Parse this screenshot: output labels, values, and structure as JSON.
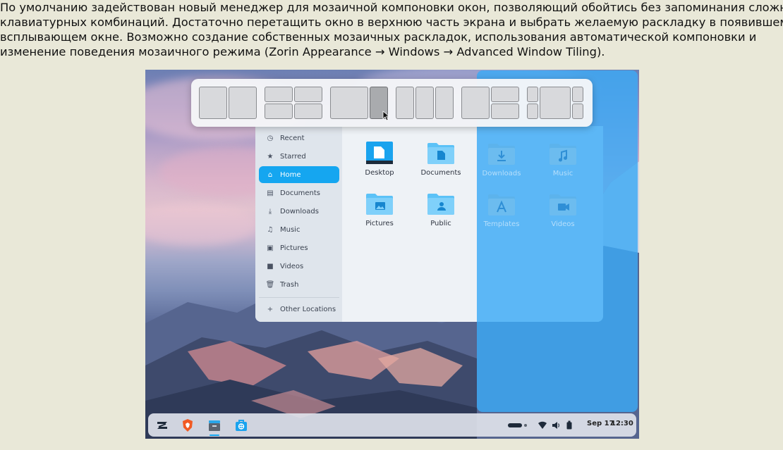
{
  "article": {
    "line1": "По умолчанию задействован новый менеджер для мозаичной компоновки окон, позволяющий обойтись без запоминания сложных",
    "line2": "клавиатурных комбинаций. Достаточно перетащить окно в верхнюю часть экрана и выбрать желаемую раскладку в появившемся",
    "line3": "всплывающем окне. Возможно создание собственных мозаичных раскладок, использования автоматической компоновки и",
    "line4": "изменение поведения мозаичного режима (Zorin Appearance → Windows → Advanced Window Tiling)."
  },
  "tiling_popup": {
    "layouts": [
      "two-columns",
      "four-grid",
      "wide-left-narrow-right",
      "three-columns",
      "left-plus-two-right",
      "center-focus"
    ],
    "highlighted_tile": "narrow-right-of-layout-3"
  },
  "files_window": {
    "sidebar": [
      {
        "label": "Recent",
        "icon": "clock-icon"
      },
      {
        "label": "Starred",
        "icon": "star-icon"
      },
      {
        "label": "Home",
        "icon": "home-icon",
        "active": true
      },
      {
        "label": "Documents",
        "icon": "document-icon"
      },
      {
        "label": "Downloads",
        "icon": "download-icon"
      },
      {
        "label": "Music",
        "icon": "music-icon"
      },
      {
        "label": "Pictures",
        "icon": "picture-icon"
      },
      {
        "label": "Videos",
        "icon": "video-icon"
      },
      {
        "label": "Trash",
        "icon": "trash-icon"
      },
      {
        "label": "Other Locations",
        "icon": "plus-icon"
      }
    ],
    "folders": [
      {
        "label": "Desktop"
      },
      {
        "label": "Documents"
      },
      {
        "label": "Downloads"
      },
      {
        "label": "Music"
      },
      {
        "label": "Pictures"
      },
      {
        "label": "Public"
      },
      {
        "label": "Templates"
      },
      {
        "label": "Videos"
      }
    ]
  },
  "taskbar": {
    "apps": [
      "zorin-menu-icon",
      "brave-browser-icon",
      "files-icon",
      "software-store-icon"
    ],
    "tray": [
      "wifi-icon",
      "volume-icon",
      "battery-icon"
    ],
    "date": "Sep 17",
    "time": "12:30"
  },
  "colors": {
    "accent": "#15a6f0",
    "snap_overlay": "#3caaf5",
    "page_background": "#e9e8d8"
  }
}
